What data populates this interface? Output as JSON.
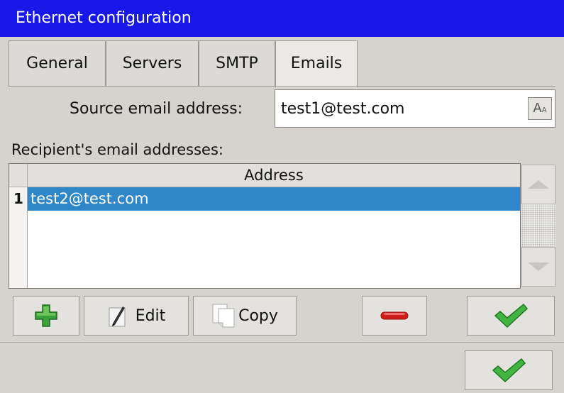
{
  "window": {
    "title": "Ethernet configuration"
  },
  "tabs": [
    {
      "label": "General"
    },
    {
      "label": "Servers"
    },
    {
      "label": "SMTP"
    },
    {
      "label": "Emails",
      "active": true
    }
  ],
  "source": {
    "label": "Source email address:",
    "value": "test1@test.com",
    "keyboard_button": "A",
    "keyboard_button_small": "A"
  },
  "recipients": {
    "label": "Recipient's email addresses:",
    "columns": [
      "Address"
    ],
    "rows": [
      {
        "num": "1",
        "address": "test2@test.com",
        "selected": true
      }
    ]
  },
  "toolbar": {
    "add_icon": "plus-icon",
    "edit_label": "Edit",
    "edit_icon": "pencil-icon",
    "copy_label": "Copy",
    "copy_icon": "copy-icon",
    "remove_icon": "minus-icon",
    "confirm_icon": "checkmark-icon"
  },
  "footer": {
    "ok_icon": "checkmark-icon"
  },
  "colors": {
    "titlebar": "#1818e8",
    "selection": "#2f86c8",
    "add_green": "#3aa23a",
    "remove_red": "#d11c1c",
    "check_green": "#41b441"
  }
}
